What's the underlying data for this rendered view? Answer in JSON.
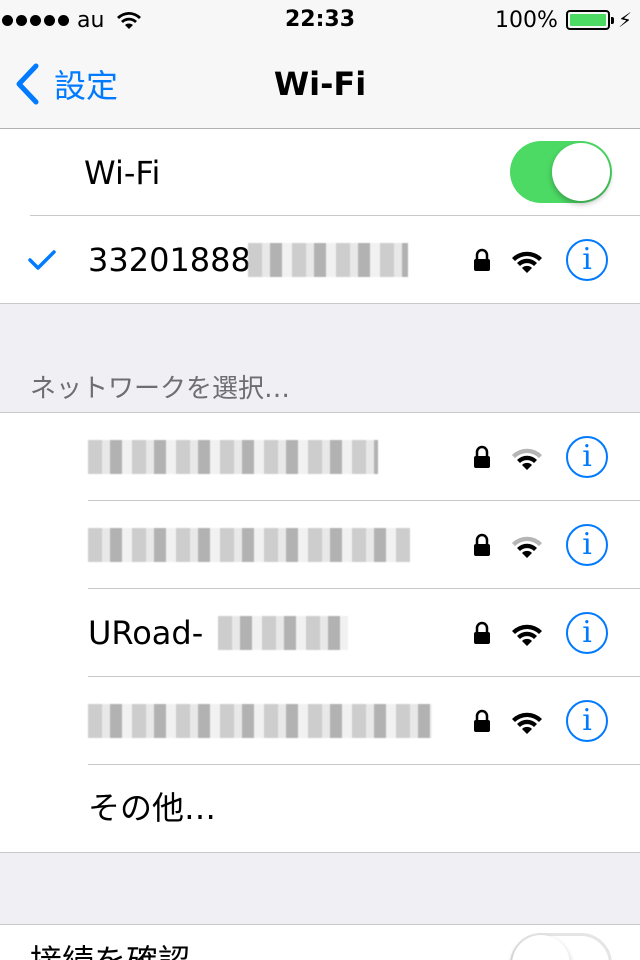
{
  "status_bar": {
    "carrier": "au",
    "time": "22:33",
    "battery": "100%",
    "battery_level": 1.0,
    "signal_bars": 5
  },
  "nav": {
    "back_label": "設定",
    "title": "Wi-Fi"
  },
  "wifi_toggle": {
    "label": "Wi-Fi",
    "state": "on"
  },
  "connected": {
    "name": "33201888",
    "secured": true,
    "signal": "strong"
  },
  "choose_header": "ネットワークを選択…",
  "networks": [
    {
      "name": "",
      "secured": true,
      "signal": "medium"
    },
    {
      "name": "",
      "secured": true,
      "signal": "medium"
    },
    {
      "name": "URoad-",
      "secured": true,
      "signal": "strong"
    },
    {
      "name": "",
      "secured": true,
      "signal": "strong"
    }
  ],
  "other_label": "その他…",
  "ask_join": {
    "label": "接続を確認",
    "state": "off"
  },
  "colors": {
    "accent": "#007aff",
    "toggle_on": "#4cd964",
    "separator": "#c8c7cc",
    "background": "#efeff4"
  },
  "icons": {
    "back": "chevron-left-icon",
    "check": "checkmark-icon",
    "lock": "lock-icon",
    "wifi": "wifi-icon",
    "info": "info-icon"
  }
}
